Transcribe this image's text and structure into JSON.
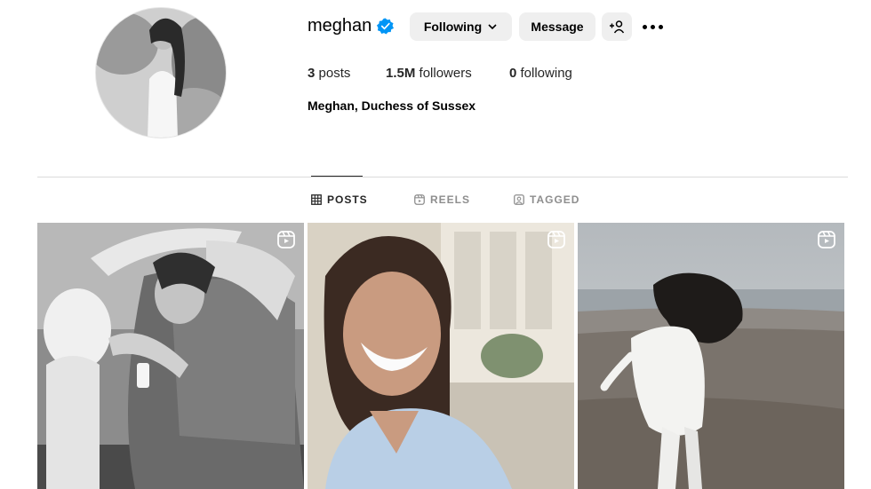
{
  "profile": {
    "username": "meghan",
    "verified": true,
    "full_name": "Meghan, Duchess of Sussex",
    "stats": {
      "posts_count": "3",
      "posts_label": " posts",
      "followers_count": "1.5M",
      "followers_label": " followers",
      "following_count": "0",
      "following_label": " following"
    }
  },
  "actions": {
    "following_label": "Following",
    "message_label": "Message"
  },
  "tabs": [
    {
      "label": "POSTS",
      "icon": "grid-icon",
      "active": true
    },
    {
      "label": "REELS",
      "icon": "reels-icon",
      "active": false
    },
    {
      "label": "TAGGED",
      "icon": "tagged-icon",
      "active": false
    }
  ],
  "posts": [
    {
      "type": "reel",
      "style": "monochrome"
    },
    {
      "type": "reel",
      "style": "color"
    },
    {
      "type": "reel",
      "style": "color"
    }
  ],
  "colors": {
    "verified_blue": "#0095f6",
    "button_bg": "#efefef",
    "muted_text": "#8e8e8e",
    "divider": "#dbdbdb"
  }
}
